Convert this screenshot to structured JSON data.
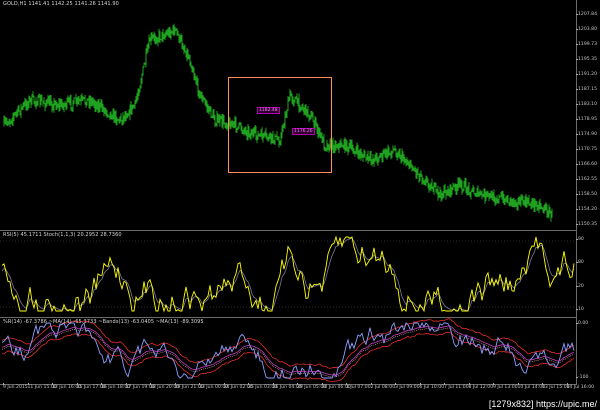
{
  "main": {
    "symbol_label": "GOLD,H1  1141.41 1142.25 1141.26 1141.90",
    "price_axis": [
      "1207.84",
      "1203.80",
      "1199.73",
      "1195.35",
      "1191.20",
      "1187.15",
      "1183.10",
      "1178.95",
      "1174.90",
      "1170.75",
      "1166.60",
      "1162.55",
      "1158.50",
      "1154.20",
      "1150.35"
    ],
    "markers": [
      "1182.48",
      "1176.26"
    ],
    "colors": {
      "bars": "#1fa21f",
      "highlight": "#ff8c5a",
      "marker": "#ff7bff"
    }
  },
  "rsi": {
    "label": "RSI(5) 45.1711  Stoch(1,1,3) 20.2952 28.7360",
    "axis": [
      "90",
      "80",
      "20",
      "10"
    ],
    "colors": {
      "stoch_main": "#ffff00",
      "stoch_signal": "#7a7a9a"
    }
  },
  "wpr": {
    "label": "%R(14) -67.3786  ~MA(14) -65.3733  ~Bands(13) -63.0405  ~MA(13) -89.3095",
    "axis": [
      "0.00",
      "-100"
    ],
    "colors": {
      "wpr": "#8aa0ff",
      "ma": "#c040c0",
      "bands": "#ff3030",
      "ma2": "#ffb0b0"
    }
  },
  "time_axis": [
    "9 Jun 2015",
    "11 Jun 15:00",
    "12 Jun 16:00",
    "15 Jun 17:00",
    "16 Jun 18:00",
    "17 Jun 19:00",
    "18 Jun 20:00",
    "19 Jun 21:00",
    "23 Jun 00:00",
    "24 Jun 02:00",
    "25 Jun 03:00",
    "26 Jun 04:00",
    "29 Jun 05:00",
    "30 Jun 06:00",
    "1 Jul 07:00",
    "2 Jul 08:00",
    "3 Jul 09:00",
    "6 Jul 10:00",
    "7 Jul 11:00",
    "8 Jul 12:00",
    "9 Jul 13:00",
    "10 Jul 14:00",
    "13 Jul 15:00",
    "14 Jul 16:00"
  ],
  "watermark": "[1279x832] https://upic.me/"
}
